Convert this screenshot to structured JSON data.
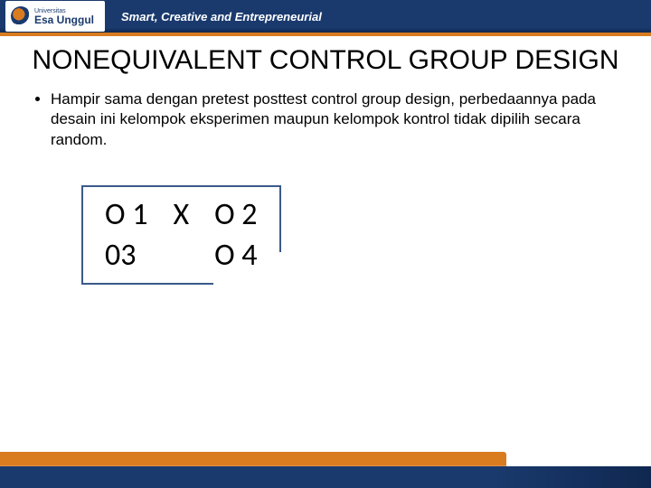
{
  "header": {
    "logo_small": "Universitas",
    "logo_main": "Esa Unggul",
    "tagline": "Smart, Creative and Entrepreneurial"
  },
  "title": "NONEQUIVALENT CONTROL GROUP DESIGN",
  "bullets": [
    "Hampir sama dengan pretest posttest control group design, perbedaannya pada desain ini kelompok eksperimen maupun kelompok kontrol tidak dipilih secara random."
  ],
  "design": {
    "row1": {
      "c1": "O 1",
      "c2": "X",
      "c3": "O 2"
    },
    "row2": {
      "c1": "03",
      "c2": "",
      "c3": "O 4"
    }
  }
}
